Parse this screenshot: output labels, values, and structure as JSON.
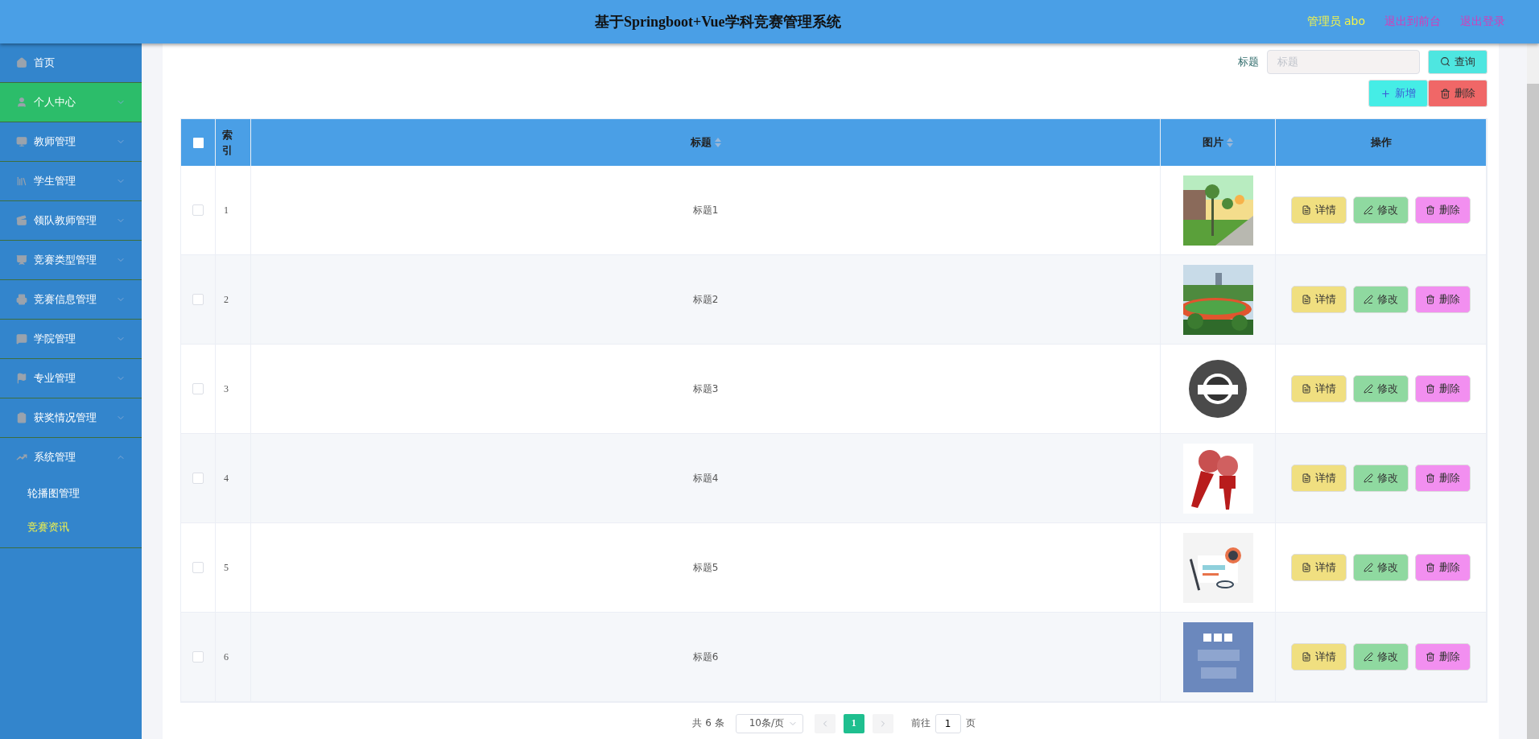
{
  "header": {
    "title": "基于Springboot+Vue学科竞赛管理系统",
    "user": "管理员 abo",
    "links": [
      "退出到前台",
      "退出登录"
    ]
  },
  "sidebar": {
    "items": [
      {
        "label": "首页",
        "selected": false
      },
      {
        "label": "个人中心",
        "selected": true,
        "expanded": false
      },
      {
        "label": "教师管理",
        "selected": false,
        "expanded": false
      },
      {
        "label": "学生管理",
        "selected": false,
        "expanded": false
      },
      {
        "label": "领队教师管理",
        "selected": false,
        "expanded": false
      },
      {
        "label": "竞赛类型管理",
        "selected": false,
        "expanded": false
      },
      {
        "label": "竞赛信息管理",
        "selected": false,
        "expanded": false
      },
      {
        "label": "学院管理",
        "selected": false,
        "expanded": false
      },
      {
        "label": "专业管理",
        "selected": false,
        "expanded": false
      },
      {
        "label": "获奖情况管理",
        "selected": false,
        "expanded": false
      },
      {
        "label": "系统管理",
        "selected": false,
        "expanded": true,
        "children": [
          {
            "label": "轮播图管理",
            "selected": false
          },
          {
            "label": "竞赛资讯",
            "selected": true
          }
        ]
      }
    ]
  },
  "search": {
    "label": "标题",
    "placeholder": "标题",
    "button": "查询"
  },
  "toolbar": [
    {
      "kind": "add",
      "label": "新增"
    },
    {
      "kind": "delete",
      "label": "删除"
    }
  ],
  "table": {
    "select_all": {
      "checked": false
    },
    "columns": [
      {
        "label": "索引",
        "sortable": false
      },
      {
        "label": "标题",
        "sortable": true
      },
      {
        "label": "图片",
        "sortable": true
      },
      {
        "label": "操作",
        "sortable": false
      }
    ],
    "rows": [
      {
        "checked": false,
        "index": "1",
        "title": "标题1",
        "image": {
          "kind": "picture"
        },
        "actions": [
          {
            "kind": "detail",
            "label": "详情"
          },
          {
            "kind": "edit",
            "label": "修改"
          },
          {
            "kind": "delete",
            "label": "删除"
          }
        ]
      },
      {
        "checked": false,
        "index": "2",
        "title": "标题2",
        "image": {
          "kind": "picture"
        },
        "actions": [
          {
            "kind": "detail",
            "label": "详情"
          },
          {
            "kind": "edit",
            "label": "修改"
          },
          {
            "kind": "delete",
            "label": "删除"
          }
        ]
      },
      {
        "checked": false,
        "index": "3",
        "title": "标题3",
        "image": {
          "kind": "picture"
        },
        "actions": [
          {
            "kind": "detail",
            "label": "详情"
          },
          {
            "kind": "edit",
            "label": "修改"
          },
          {
            "kind": "delete",
            "label": "删除"
          }
        ]
      },
      {
        "checked": false,
        "index": "4",
        "title": "标题4",
        "image": {
          "kind": "picture"
        },
        "actions": [
          {
            "kind": "detail",
            "label": "详情"
          },
          {
            "kind": "edit",
            "label": "修改"
          },
          {
            "kind": "delete",
            "label": "删除"
          }
        ]
      },
      {
        "checked": false,
        "index": "5",
        "title": "标题5",
        "image": {
          "kind": "picture"
        },
        "actions": [
          {
            "kind": "detail",
            "label": "详情"
          },
          {
            "kind": "edit",
            "label": "修改"
          },
          {
            "kind": "delete",
            "label": "删除"
          }
        ]
      },
      {
        "checked": false,
        "index": "6",
        "title": "标题6",
        "image": {
          "kind": "picture"
        },
        "actions": [
          {
            "kind": "detail",
            "label": "详情"
          },
          {
            "kind": "edit",
            "label": "修改"
          },
          {
            "kind": "delete",
            "label": "删除"
          }
        ]
      }
    ]
  },
  "pagination": {
    "total": "共 6 条",
    "page_size": "10条/页",
    "pages": [
      {
        "label": "1",
        "selected": true
      }
    ],
    "goto_label": "前往",
    "goto_value": "1",
    "goto_suffix": "页"
  }
}
